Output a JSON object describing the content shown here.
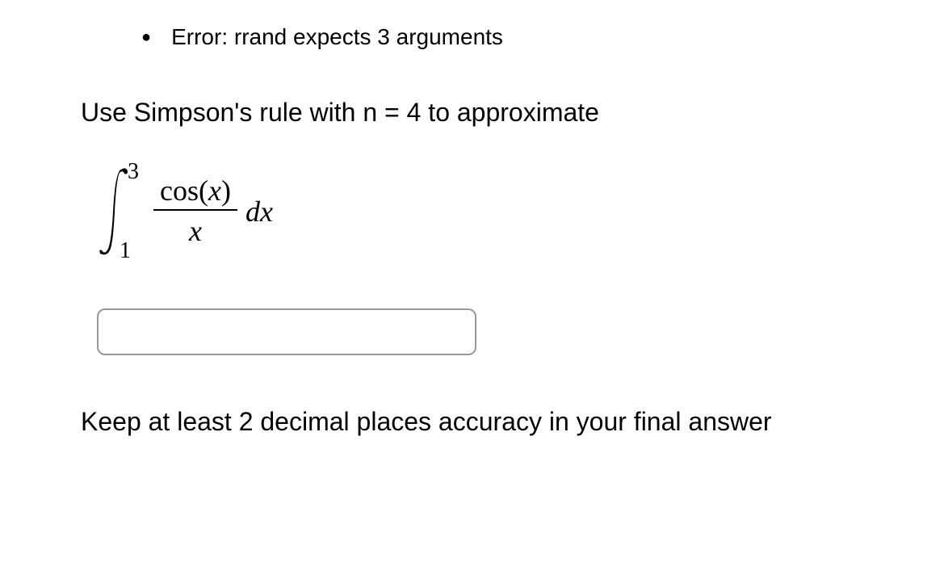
{
  "bullet": {
    "symbol": "●",
    "text": "Error: rrand expects 3 arguments"
  },
  "prompt": "Use Simpson's rule with n = 4 to approximate",
  "integral": {
    "upper": "3",
    "lower": "1",
    "cos_label": "cos",
    "var": "x",
    "dx": "dx"
  },
  "answer_value": "",
  "instruction": "Keep at least 2 decimal places accuracy in your final answer"
}
